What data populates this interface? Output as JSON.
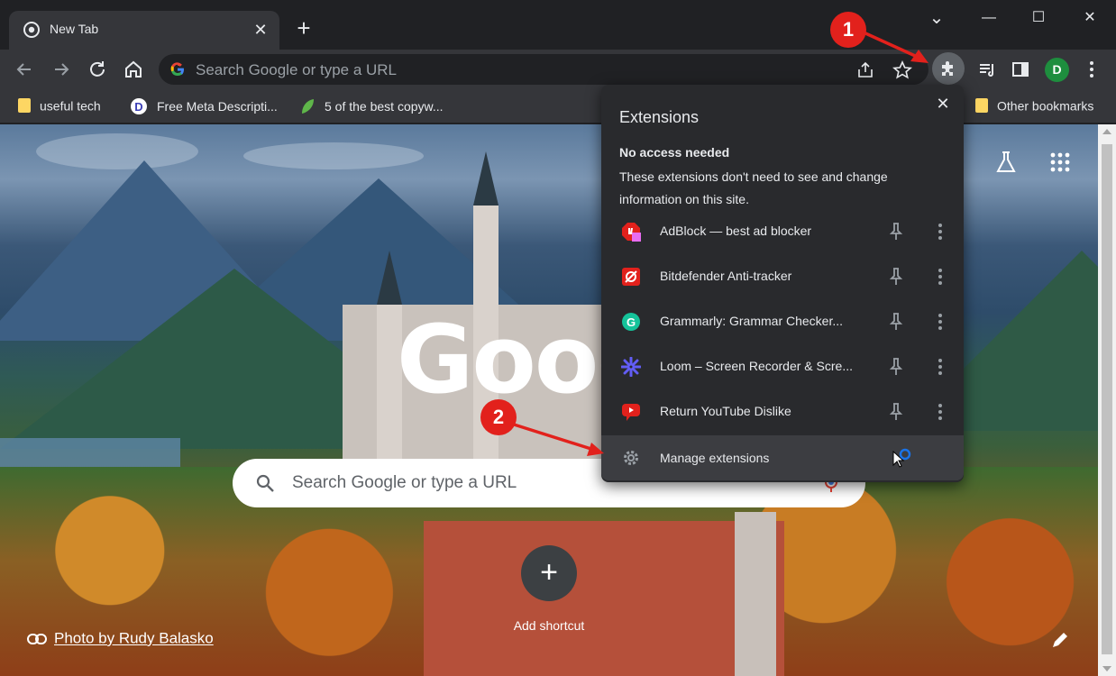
{
  "tab": {
    "title": "New Tab",
    "close": "✕"
  },
  "newtab": "+",
  "window": {
    "dropdown": "⌄",
    "minimize": "—",
    "maximize": "☐",
    "close": "✕"
  },
  "omnibox": {
    "placeholder": "Search Google or type a URL"
  },
  "profile": {
    "initial": "D",
    "color": "#1e8e3e"
  },
  "bookmarks": [
    {
      "label": "useful tech",
      "icon": "folder-icon"
    },
    {
      "label": "Free Meta Descripti...",
      "icon": "d-logo-icon"
    },
    {
      "label": "5 of the best copyw...",
      "icon": "leaf-icon"
    },
    {
      "label": "Other bookmarks",
      "icon": "folder-icon"
    }
  ],
  "ntp": {
    "logo": "Goog",
    "search_placeholder": "Search Google or type a URL",
    "shortcut_label": "Add shortcut",
    "photo_credit": "Photo by Rudy Balasko"
  },
  "extensions_popup": {
    "title": "Extensions",
    "section_title": "No access needed",
    "section_desc": "These extensions don't need to see and change information on this site.",
    "items": [
      {
        "name": "AdBlock — best ad blocker",
        "icon": "adblock-icon",
        "color": "#e2211c"
      },
      {
        "name": "Bitdefender Anti-tracker",
        "icon": "bitdefender-icon",
        "color": "#e2211c"
      },
      {
        "name": "Grammarly: Grammar Checker...",
        "icon": "grammarly-icon",
        "color": "#15c39a"
      },
      {
        "name": "Loom – Screen Recorder & Scre...",
        "icon": "loom-icon",
        "color": "#625df5"
      },
      {
        "name": "Return YouTube Dislike",
        "icon": "dislike-icon",
        "color": "#e2211c"
      }
    ],
    "manage_label": "Manage extensions"
  },
  "callouts": {
    "one": "1",
    "two": "2",
    "color": "#e2211c"
  },
  "colors": {
    "accent_blue": "#1a73e8",
    "popup_bg": "#292a2d"
  }
}
